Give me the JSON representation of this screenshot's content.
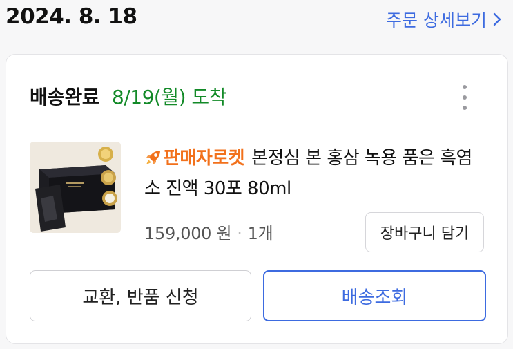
{
  "header": {
    "order_date": "2024. 8. 18",
    "detail_link_label": "주문 상세보기"
  },
  "delivery": {
    "status": "배송완료",
    "arrival": "8/19(월) 도착"
  },
  "product": {
    "seller_badge": "판매자로켓",
    "title": "본정심 본 홍삼 녹용 품은 흑염소 진액 30포 80ml",
    "price": "159,000 원",
    "separator": "·",
    "quantity": "1개",
    "cart_button_label": "장바구니 담기"
  },
  "actions": {
    "exchange_label": "교환, 반품 신청",
    "track_label": "배송조회"
  },
  "colors": {
    "accent_blue": "#3d6be0",
    "arrival_green": "#138a28",
    "seller_orange": "#f2711c"
  },
  "icons": {
    "detail_chevron": "chevron-right-icon",
    "more": "more-vertical-icon",
    "seller": "rocket-icon"
  }
}
